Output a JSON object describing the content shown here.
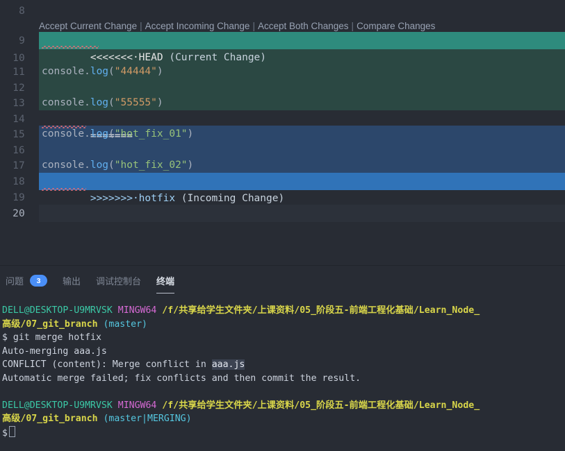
{
  "editor": {
    "codelens": {
      "accept_current": "Accept Current Change",
      "accept_incoming": "Accept Incoming Change",
      "accept_both": "Accept Both Changes",
      "compare": "Compare Changes",
      "separator": "|"
    },
    "lines": [
      {
        "num": "8",
        "text": ""
      },
      {
        "num": "9",
        "text": "<<<<<<<·HEAD (Current Change)"
      },
      {
        "num": "10",
        "text": ""
      },
      {
        "num": "11",
        "text": "console.log(\"44444\")"
      },
      {
        "num": "12",
        "text": ""
      },
      {
        "num": "13",
        "text": "console.log(\"55555\")"
      },
      {
        "num": "14",
        "text": "======="
      },
      {
        "num": "15",
        "text": "console.log(\"hot_fix_01\")"
      },
      {
        "num": "16",
        "text": ""
      },
      {
        "num": "17",
        "text": "console.log(\"hot_fix_02\")"
      },
      {
        "num": "18",
        "text": ">>>>>>>·hotfix (Incoming Change)"
      },
      {
        "num": "19",
        "text": ""
      },
      {
        "num": "20",
        "text": ""
      }
    ],
    "tokens": {
      "console_obj": "console",
      "dot": ".",
      "log": "log",
      "paren_open": "(",
      "paren_close": ")",
      "str_44444": "\"44444\"",
      "str_55555": "\"55555\"",
      "str_hot_fix_01": "\"hot_fix_01\"",
      "str_hot_fix_02": "\"hot_fix_02\"",
      "marker_head": "<<<<<<<·HEAD",
      "label_current": " (Current Change)",
      "marker_sep": "=======",
      "marker_hotfix": ">>>>>>>·hotfix",
      "label_incoming": " (Incoming Change)"
    },
    "colors": {
      "background": "#282c34",
      "current_header": "#2e8b7d",
      "current_body": "#2b4843",
      "incoming_header": "#3073b8",
      "incoming_body": "#2c476b",
      "line_number": "#5c6370",
      "squiggle": "#e06c75"
    }
  },
  "panel": {
    "tabs": [
      {
        "label": "问题",
        "badge": "3",
        "active": false
      },
      {
        "label": "输出",
        "badge": "",
        "active": false
      },
      {
        "label": "调试控制台",
        "badge": "",
        "active": false
      },
      {
        "label": "终端",
        "badge": "",
        "active": true
      }
    ],
    "terminal": {
      "prompt1": {
        "user_host": "DELL@DESKTOP-U9MRVSK",
        "shell": "MINGW64",
        "path_line1": "/f/共享给学生文件夹/上课资料/05_阶段五-前端工程化基础/Learn_Node_",
        "path_line2": "高级/07_git_branch",
        "branch": "(master)"
      },
      "command": "$ git merge hotfix",
      "output": [
        "Auto-merging aaa.js",
        "Automatic merge failed; fix conflicts and then commit the result."
      ],
      "conflict_line": {
        "prefix": "CONFLICT (content): Merge conflict in ",
        "file": "aaa.js"
      },
      "prompt2": {
        "user_host": "DELL@DESKTOP-U9MRVSK",
        "shell": "MINGW64",
        "path_line1": "/f/共享给学生文件夹/上课资料/05_阶段五-前端工程化基础/Learn_Node_",
        "path_line2": "高级/07_git_branch",
        "branch": "(master|MERGING)"
      },
      "prompt_symbol": "$"
    },
    "colors": {
      "badge": "#4a8ff7",
      "green": "#3bc9a6",
      "magenta": "#d66ad4",
      "yellow": "#d9d64a",
      "cyan": "#55c7e0"
    }
  }
}
